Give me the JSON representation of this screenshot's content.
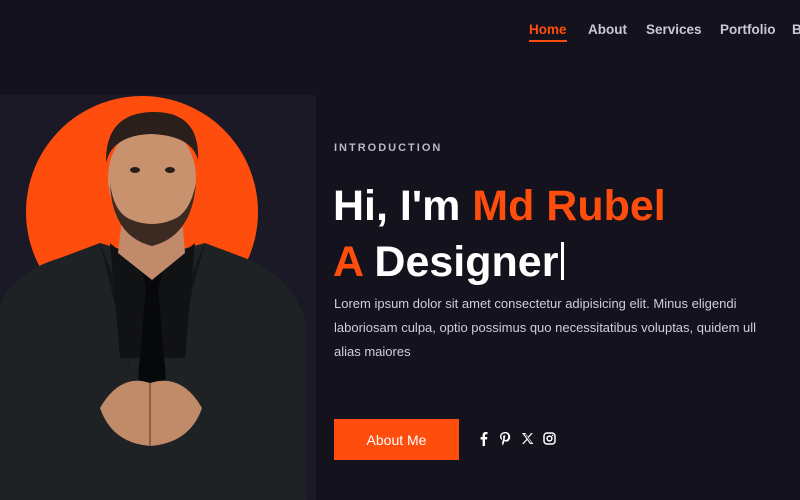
{
  "nav": {
    "items": [
      {
        "label": "Home",
        "active": true
      },
      {
        "label": "About",
        "active": false
      },
      {
        "label": "Services",
        "active": false
      },
      {
        "label": "Portfolio",
        "active": false
      },
      {
        "label": "B",
        "active": false
      }
    ]
  },
  "hero": {
    "eyebrow": "INTRODUCTION",
    "greeting": "Hi, I'm ",
    "name": "Md Rubel",
    "role_prefix": "A",
    "role": " Designer",
    "description_lines": [
      "Lorem ipsum dolor sit amet consectetur adipisicing elit. Minus eligendi",
      "laboriosam culpa, optio possimus quo necessitatibus voluptas, quidem ull",
      "alias maiores"
    ],
    "cta_label": "About Me",
    "socials": [
      "facebook-icon",
      "pinterest-icon",
      "x-icon",
      "instagram-icon"
    ]
  },
  "colors": {
    "background": "#14121c",
    "panel": "#1b1925",
    "accent": "#ff4d0d",
    "text": "#ffffff",
    "muted": "#c9c8d4"
  }
}
